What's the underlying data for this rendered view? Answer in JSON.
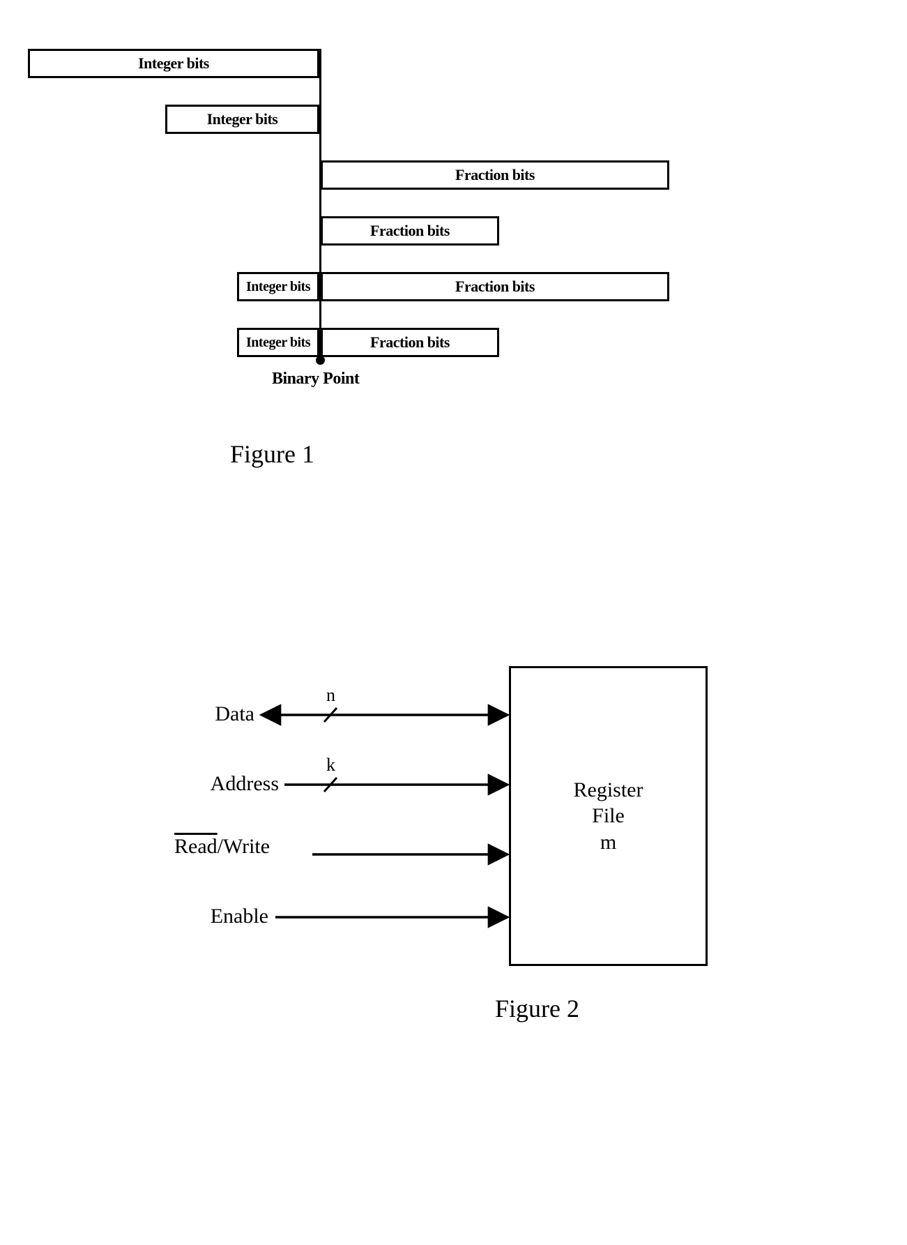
{
  "figure1": {
    "boxes": {
      "r1_int": "Integer bits",
      "r2_int": "Integer bits",
      "r3_frac": "Fraction bits",
      "r4_frac": "Fraction bits",
      "r5_int": "Integer bits",
      "r5_frac": "Fraction bits",
      "r6_int": "Integer bits",
      "r6_frac": "Fraction bits"
    },
    "binary_point_label": "Binary Point",
    "caption": "Figure 1"
  },
  "figure2": {
    "signals": {
      "data": "Data",
      "address": "Address",
      "read": "Read",
      "write": "/Write",
      "enable": "Enable"
    },
    "bus_widths": {
      "data": "n",
      "address": "k"
    },
    "block": {
      "line1": "Register",
      "line2": "File",
      "line3": "m"
    },
    "caption": "Figure 2"
  }
}
